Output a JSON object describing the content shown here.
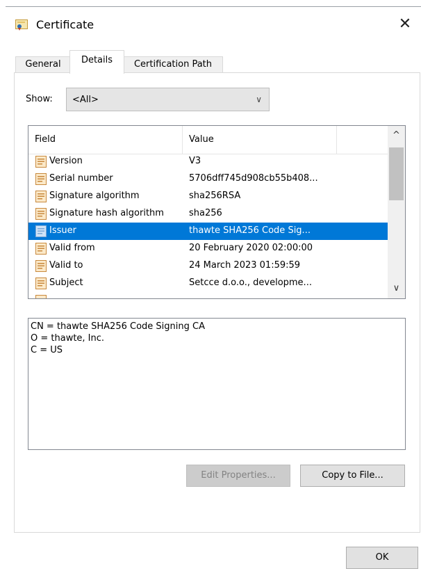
{
  "window": {
    "title": "Certificate",
    "icon": "certificate-icon",
    "close_glyph": "✕"
  },
  "tabs": [
    {
      "label": "General",
      "active": false
    },
    {
      "label": "Details",
      "active": true
    },
    {
      "label": "Certification Path",
      "active": false
    }
  ],
  "show": {
    "label": "Show:",
    "selected": "<All>",
    "chevron": "∨"
  },
  "list": {
    "headers": {
      "field": "Field",
      "value": "Value"
    },
    "rows": [
      {
        "field": "Version",
        "value": "V3",
        "selected": false
      },
      {
        "field": "Serial number",
        "value": "5706dff745d908cb55b408...",
        "selected": false
      },
      {
        "field": "Signature algorithm",
        "value": "sha256RSA",
        "selected": false
      },
      {
        "field": "Signature hash algorithm",
        "value": "sha256",
        "selected": false
      },
      {
        "field": "Issuer",
        "value": "thawte SHA256 Code Sig...",
        "selected": true
      },
      {
        "field": "Valid from",
        "value": "20 February 2020 02:00:00",
        "selected": false
      },
      {
        "field": "Valid to",
        "value": "24 March 2023 01:59:59",
        "selected": false
      },
      {
        "field": "Subject",
        "value": "Setcce d.o.o., developme...",
        "selected": false
      }
    ],
    "scroll_up": "^",
    "scroll_down": "∨"
  },
  "detail_lines": [
    "CN = thawte SHA256 Code Signing CA",
    "O = thawte, Inc.",
    "C = US"
  ],
  "buttons": {
    "edit_properties": "Edit Properties...",
    "copy_to_file": "Copy to File...",
    "ok": "OK"
  },
  "colors": {
    "selection": "#0078d7",
    "disabled_button": "#cccccc"
  }
}
